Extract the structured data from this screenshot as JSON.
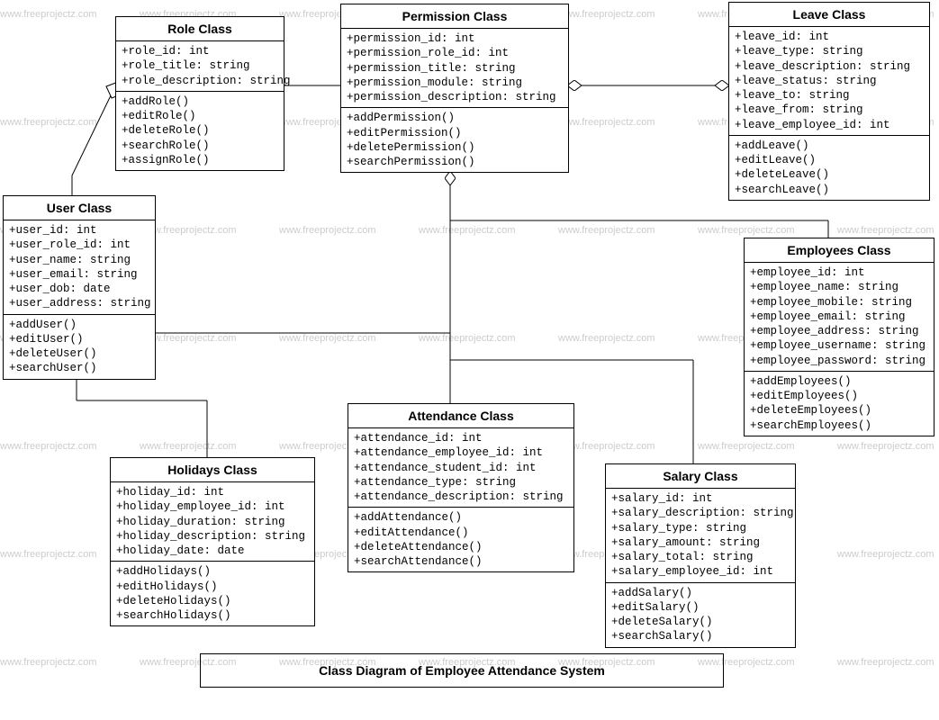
{
  "watermark_text": "www.freeprojectz.com",
  "diagram_title": "Class Diagram of Employee Attendance System",
  "classes": {
    "role": {
      "name": "Role Class",
      "attrs": [
        "+role_id: int",
        "+role_title: string",
        "+role_description: string"
      ],
      "methods": [
        "+addRole()",
        "+editRole()",
        "+deleteRole()",
        "+searchRole()",
        "+assignRole()"
      ]
    },
    "permission": {
      "name": "Permission Class",
      "attrs": [
        "+permission_id: int",
        "+permission_role_id: int",
        "+permission_title: string",
        "+permission_module: string",
        "+permission_description: string"
      ],
      "methods": [
        "+addPermission()",
        "+editPermission()",
        "+deletePermission()",
        "+searchPermission()"
      ]
    },
    "leave": {
      "name": "Leave Class",
      "attrs": [
        "+leave_id: int",
        "+leave_type: string",
        "+leave_description: string",
        "+leave_status: string",
        "+leave_to: string",
        "+leave_from: string",
        "+leave_employee_id: int"
      ],
      "methods": [
        "+addLeave()",
        "+editLeave()",
        "+deleteLeave()",
        "+searchLeave()"
      ]
    },
    "user": {
      "name": "User Class",
      "attrs": [
        "+user_id: int",
        "+user_role_id: int",
        "+user_name: string",
        "+user_email: string",
        "+user_dob: date",
        "+user_address: string"
      ],
      "methods": [
        "+addUser()",
        "+editUser()",
        "+deleteUser()",
        "+searchUser()"
      ]
    },
    "employees": {
      "name": "Employees Class",
      "attrs": [
        "+employee_id: int",
        "+employee_name: string",
        "+employee_mobile: string",
        "+employee_email: string",
        "+employee_address: string",
        "+employee_username: string",
        "+employee_password: string"
      ],
      "methods": [
        "+addEmployees()",
        "+editEmployees()",
        "+deleteEmployees()",
        "+searchEmployees()"
      ]
    },
    "attendance": {
      "name": "Attendance Class",
      "attrs": [
        "+attendance_id: int",
        "+attendance_employee_id: int",
        "+attendance_student_id: int",
        "+attendance_type: string",
        "+attendance_description: string"
      ],
      "methods": [
        "+addAttendance()",
        "+editAttendance()",
        "+deleteAttendance()",
        "+searchAttendance()"
      ]
    },
    "holidays": {
      "name": "Holidays Class",
      "attrs": [
        "+holiday_id: int",
        "+holiday_employee_id: int",
        "+holiday_duration: string",
        "+holiday_description: string",
        "+holiday_date: date"
      ],
      "methods": [
        "+addHolidays()",
        "+editHolidays()",
        "+deleteHolidays()",
        "+searchHolidays()"
      ]
    },
    "salary": {
      "name": "Salary Class",
      "attrs": [
        "+salary_id: int",
        "+salary_description: string",
        "+salary_type: string",
        "+salary_amount: string",
        "+salary_total: string",
        "+salary_employee_id: int"
      ],
      "methods": [
        "+addSalary()",
        "+editSalary()",
        "+deleteSalary()",
        "+searchSalary()"
      ]
    }
  }
}
